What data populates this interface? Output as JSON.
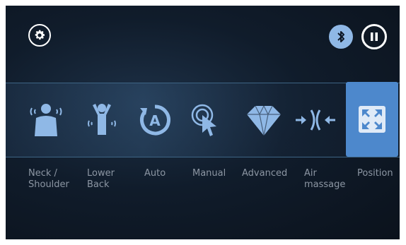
{
  "header": {
    "settings_icon": "gear-icon",
    "bluetooth_icon": "bluetooth-icon",
    "pause_icon": "pause-icon"
  },
  "menu": {
    "items": [
      {
        "label": "Neck /\nShoulder",
        "icon": "neck-shoulder-icon"
      },
      {
        "label": "Lower\nBack",
        "icon": "lower-back-icon"
      },
      {
        "label": "Auto",
        "icon": "auto-icon"
      },
      {
        "label": "Manual",
        "icon": "manual-icon"
      },
      {
        "label": "Advanced",
        "icon": "diamond-icon"
      },
      {
        "label": "Air\nmassage",
        "icon": "air-massage-icon"
      },
      {
        "label": "Position",
        "icon": "position-icon",
        "selected": true
      }
    ]
  },
  "colors": {
    "background": "#0b121c",
    "accent": "#4d88cc",
    "icon": "#8fb8e6",
    "label": "#8c96a3"
  }
}
